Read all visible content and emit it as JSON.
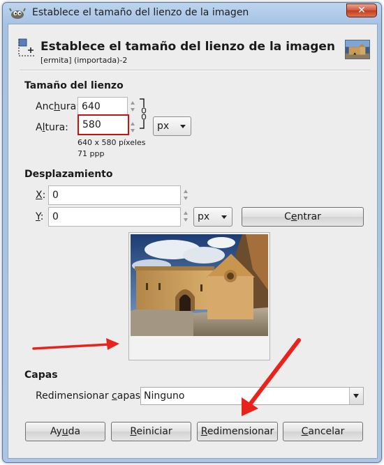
{
  "window": {
    "title": "Establece el tamaño del lienzo de la imagen",
    "close_glyph": "✕"
  },
  "header": {
    "title": "Establece el tamaño del lienzo de la imagen",
    "subtitle": "[ermita] (importada)-2"
  },
  "canvas_size": {
    "section": "Tamaño del lienzo",
    "width_label_pre": "Anc",
    "width_label_u": "h",
    "width_label_post": "ura:",
    "width_value": "640",
    "height_label_pre": "A",
    "height_label_u": "l",
    "height_label_post": "tura:",
    "height_value": "580",
    "unit": "px",
    "info_pixels": "640 x 580 píxeles",
    "info_ppp": "71 ppp"
  },
  "offset": {
    "section": "Desplazamiento",
    "x_label": "X",
    "x_value": "0",
    "y_label": "Y",
    "y_value": "0",
    "unit": "px",
    "center_pre": "C",
    "center_u": "e",
    "center_post": "ntrar"
  },
  "layers": {
    "section": "Capas",
    "resize_label_pre": "Redimensionar ",
    "resize_label_u": "c",
    "resize_label_post": "apas:",
    "resize_value": "Ninguno"
  },
  "buttons": {
    "help_pre": "Ay",
    "help_u": "u",
    "help_post": "da",
    "reset_pre": "",
    "reset_u": "R",
    "reset_post": "einiciar",
    "resize_pre": "",
    "resize_u": "R",
    "resize_post": "edimensionar",
    "cancel_pre": "",
    "cancel_u": "C",
    "cancel_post": "ancelar"
  },
  "colors": {
    "annotation": "#e8231c",
    "highlight_box": "#cc1111"
  },
  "icons": [
    "gimp-icon",
    "close-icon",
    "canvas-size-icon",
    "chain-link-icon",
    "chevron-down-icon"
  ]
}
